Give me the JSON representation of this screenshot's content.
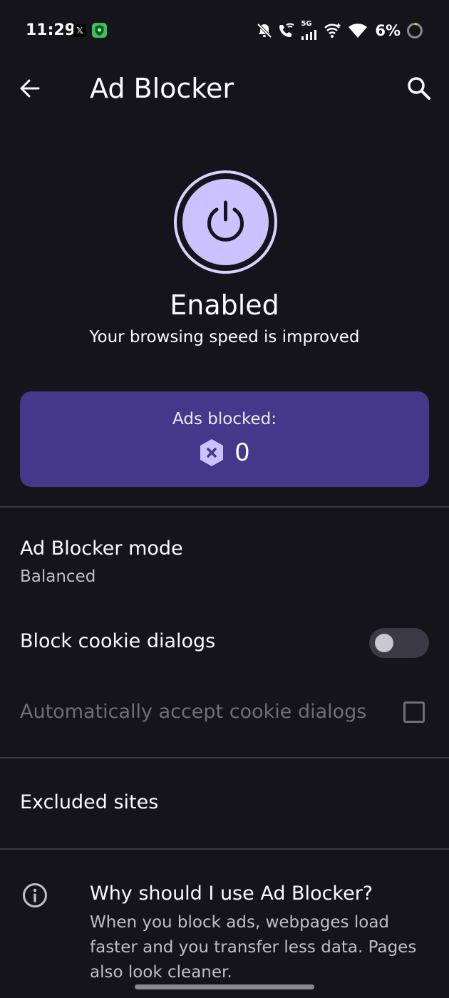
{
  "status_bar": {
    "time": "11:29",
    "x_app_glyph": "𝕏",
    "network": "5G",
    "battery": "6%",
    "icons": [
      "x-app-icon",
      "vpn-shield-icon",
      "bell-off-icon",
      "wifi-calling-icon",
      "cell-signal-icon",
      "hotspot-icon",
      "wifi-icon",
      "battery-ring-icon"
    ]
  },
  "toolbar": {
    "title": "Ad Blocker",
    "back_icon": "back-arrow-icon",
    "search_icon": "search-icon"
  },
  "power": {
    "icon": "power-icon",
    "state": "Enabled",
    "subtitle": "Your browsing speed is improved"
  },
  "ads_card": {
    "label": "Ads blocked:",
    "icon": "blocked-hexagon-icon",
    "count": "0"
  },
  "settings": {
    "mode_title": "Ad Blocker mode",
    "mode_value": "Balanced",
    "cookie_toggle_label": "Block cookie dialogs",
    "cookie_toggle_on": false,
    "auto_accept_label": "Automatically accept cookie dialogs",
    "auto_accept_checked": false,
    "excluded_sites_label": "Excluded sites"
  },
  "info": {
    "icon": "info-icon",
    "title": "Why should I use Ad Blocker?",
    "body": "When you block ads, webpages load faster and you transfer less data. Pages also look cleaner."
  },
  "colors": {
    "background": "#15141b",
    "accent": "#cbc2ff",
    "card": "#45388a",
    "divider": "#3a3944"
  }
}
